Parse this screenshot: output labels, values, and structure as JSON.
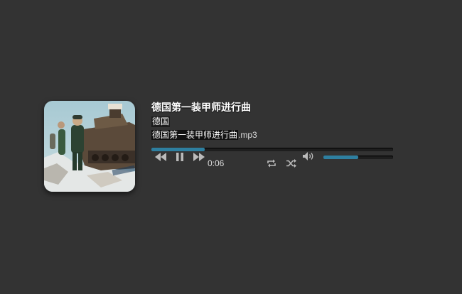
{
  "track": {
    "title": "德国第一装甲师进行曲",
    "artist": "德国",
    "filename_base": "德国第一装甲师进行曲",
    "filename_ext": ".mp3",
    "elapsed": "0:06",
    "progress": 0.22,
    "volume": 0.5
  },
  "icons": {
    "previous": "previous-icon",
    "pause": "pause-icon",
    "next": "next-icon",
    "repeat": "repeat-icon",
    "shuffle": "shuffle-icon",
    "volume": "volume-icon"
  },
  "colors": {
    "background": "#333333",
    "accent": "#2e7fa0",
    "track_bg": "#1e1e1e",
    "icon": "#bbbbbb"
  }
}
